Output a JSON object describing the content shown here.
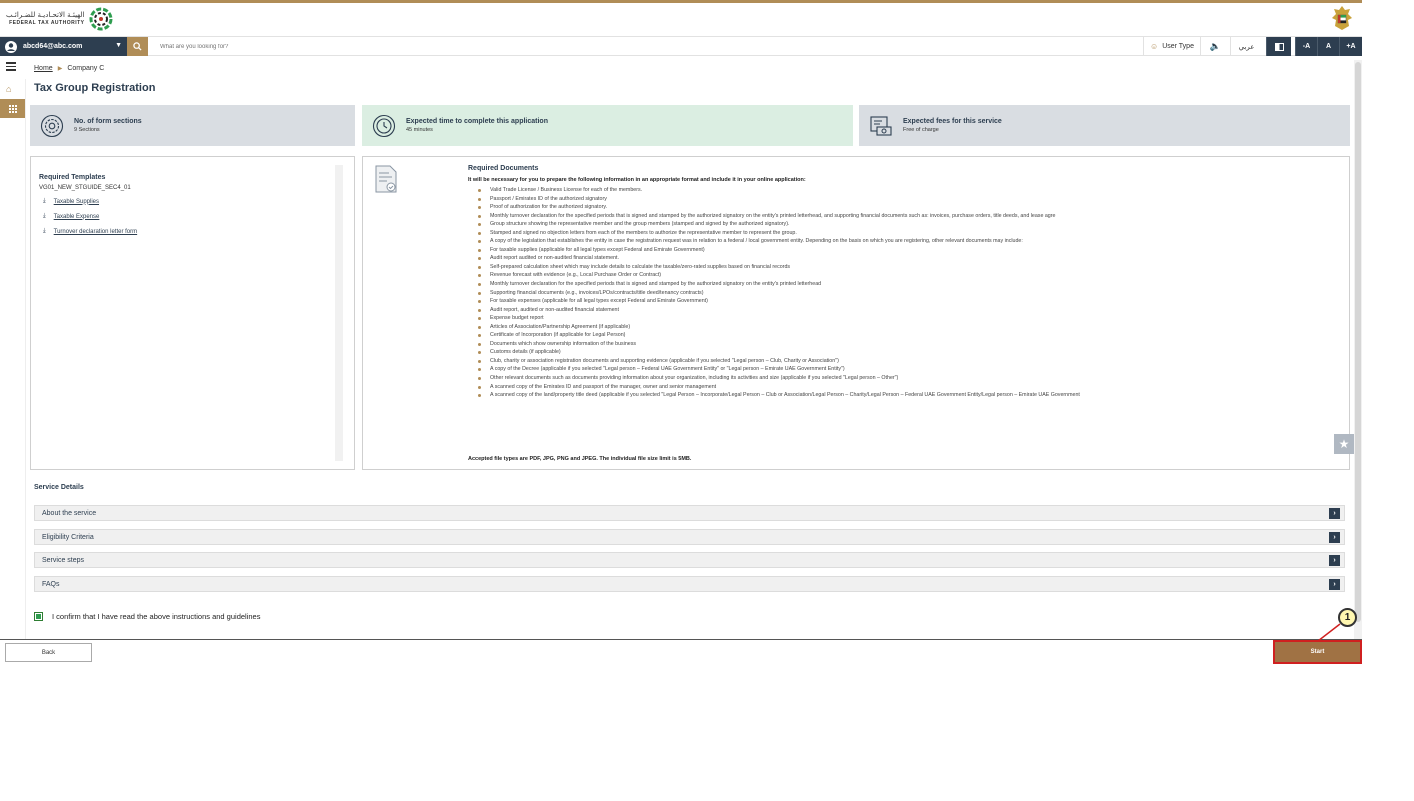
{
  "header": {
    "logo_ar": "الهيئـة الاتحـاديـة للضـرائـب",
    "logo_en": "FEDERAL TAX AUTHORITY"
  },
  "topbar": {
    "user_email": "abcd64@abc.com",
    "search_placeholder": "What are you looking for?",
    "user_type": "User Type",
    "language": "عربي",
    "font_decrease": "-A",
    "font_default": "A",
    "font_increase": "+A"
  },
  "breadcrumb": {
    "home": "Home",
    "current": "Company C"
  },
  "page_title": "Tax Group Registration",
  "cards": [
    {
      "title": "No. of form sections",
      "sub": "9 Sections",
      "color": "#d9dde2"
    },
    {
      "title": "Expected time to complete this application",
      "sub": "45 minutes",
      "color": "#dbeee2"
    },
    {
      "title": "Expected fees for this service",
      "sub": "Free of charge",
      "color": "#d9dde2"
    }
  ],
  "templates": {
    "title": "Required Templates",
    "code": "VG01_NEW_STGUIDE_SEC4_01",
    "links": [
      "Taxable Supplies",
      "Taxable Expense",
      "Turnover declaration letter form"
    ]
  },
  "documents": {
    "title": "Required Documents",
    "intro": "It will be necessary for you to prepare the following information in an appropriate format and include it in your online application:",
    "items": [
      "Valid Trade License / Business License for each of the members.",
      "Passport / Emirates ID of the authorized signatory",
      "Proof of authorization for the authorized signatory.",
      "Monthly turnover declaration for the specified periods that is signed and stamped by the authorized signatory on the entity's printed letterhead, and supporting financial documents such as: invoices, purchase orders, title deeds, and lease agre",
      "Group structure showing the representative member and the group members (stamped and signed by the authorized signatory).",
      "Stamped and signed no objection letters from each of the members to authorize the representative member to represent the group.",
      "A copy of the legislation that establishes the entity in case the registration request was in relation to a federal / local government entity. Depending on the basis on which you are registering, other relevant documents may include:",
      "For taxable supplies (applicable for all legal types except Federal and Emirate Government)",
      "Audit report audited or non-audited financial statement.",
      "Self-prepared calculation sheet which may include details to calculate the taxable/zero-rated supplies based on financial records",
      "Revenue forecast with evidence (e.g., Local Purchase Order or Contract)",
      "Monthly turnover declaration for the specified periods that is signed and stamped by the authorized signatory on the entity's printed letterhead",
      "Supporting financial documents (e.g., invoices/LPOs/contracts/title deed/tenancy contracts)",
      "For taxable expenses (applicable for all legal types except Federal and Emirate Government)",
      "Audit report, audited or non-audited financial statement",
      "Expense budget report",
      "Articles of Association/Partnership Agreement (if applicable)",
      "Certificate of Incorporation (if applicable for Legal Person)",
      "Documents which show ownership information of the business",
      "Customs details (if applicable)",
      "Club, charity or association registration documents and supporting evidence (applicable if you selected \"Legal person – Club, Charity or Association\")",
      "A copy of the Decree (applicable if you selected \"Legal person – Federal UAE Government Entity\" or \"Legal person – Emirate UAE Government Entity\")",
      "Other relevant documents such as documents providing information about your organization, including its activities and size (applicable if you selected \"Legal person – Other\")",
      "A scanned copy of the Emirates ID and passport of the manager, owner and senior management",
      "A scanned copy of the land/property title deed (applicable if you selected \"Legal Person – Incorporate/Legal Person – Club or Association/Legal Person – Charity/Legal Person – Federal UAE Government Entity/Legal person – Emirate UAE Government"
    ],
    "accepted": "Accepted file types are PDF, JPG, PNG and JPEG. The individual file size limit is 5MB."
  },
  "service_details": {
    "title": "Service Details",
    "sections": [
      "About the service",
      "Eligibility Criteria",
      "Service steps",
      "FAQs"
    ]
  },
  "confirm_text": "I confirm that I have read the above instructions and guidelines",
  "confirm_checked": true,
  "footer": {
    "back": "Back",
    "start": "Start"
  },
  "step_badge": "1",
  "colors": {
    "brand_gold": "#b08d57",
    "navy": "#2d3e50",
    "start_button": "#a07244",
    "highlight": "#d02020"
  }
}
